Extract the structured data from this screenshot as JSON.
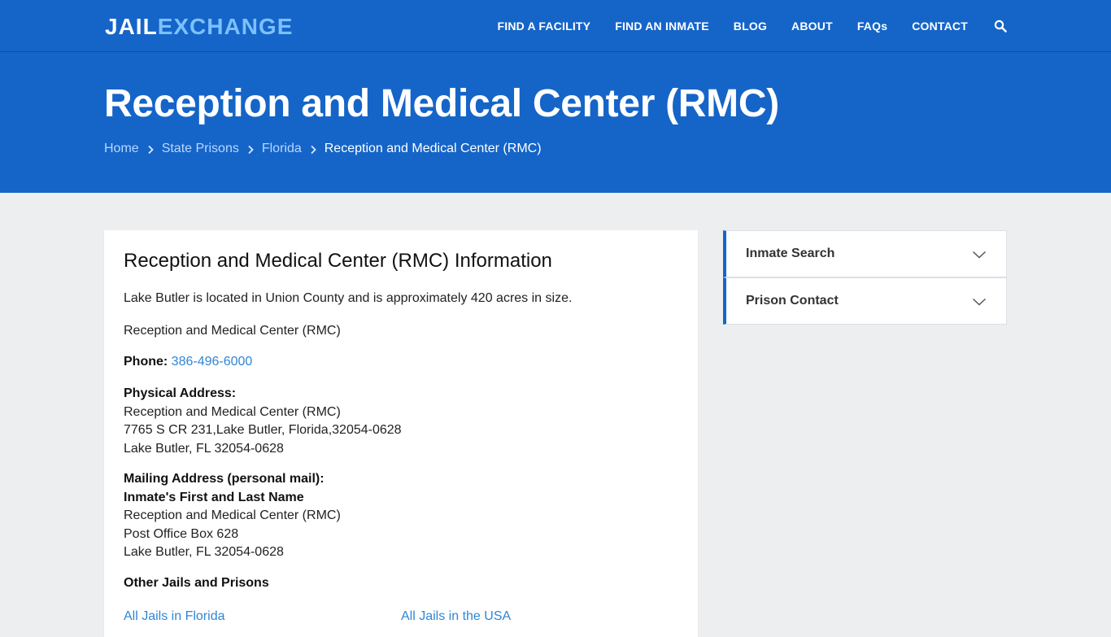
{
  "header": {
    "logo_part1": "JAIL",
    "logo_part2": "EXCHANGE",
    "nav": [
      "FIND A FACILITY",
      "FIND AN INMATE",
      "BLOG",
      "ABOUT",
      "FAQs",
      "CONTACT"
    ],
    "search_icon": "search-icon"
  },
  "hero": {
    "title": "Reception and Medical Center (RMC)",
    "breadcrumbs": [
      "Home",
      "State Prisons",
      "Florida"
    ],
    "breadcrumb_current": "Reception and Medical Center (RMC)"
  },
  "main": {
    "heading": "Reception and Medical Center (RMC) Information",
    "intro": "Lake Butler is located in Union County and is approximately 420 acres in size.",
    "facility_name": "Reception and Medical Center (RMC)",
    "phone_label": "Phone:",
    "phone": "386-496-6000",
    "physical_label": "Physical Address:",
    "physical_lines": [
      "Reception and Medical Center (RMC)",
      "7765 S CR 231,Lake Butler, Florida,32054-0628",
      "Lake Butler, FL 32054-0628"
    ],
    "mailing_label": "Mailing Address (personal mail):",
    "mailing_name": "Inmate's First and Last Name",
    "mailing_lines": [
      "Reception and Medical Center (RMC)",
      "Post Office Box 628",
      "Lake Butler, FL 32054-0628"
    ],
    "other_heading": "Other Jails and Prisons",
    "links": [
      "All Jails in Florida",
      "All Jails in the USA"
    ]
  },
  "sidebar": {
    "items": [
      "Inmate Search",
      "Prison Contact"
    ]
  },
  "colors": {
    "brand_blue": "#1565c8",
    "logo_accent": "#7cc0ff",
    "link": "#2f86d6",
    "background": "#eceef0"
  }
}
